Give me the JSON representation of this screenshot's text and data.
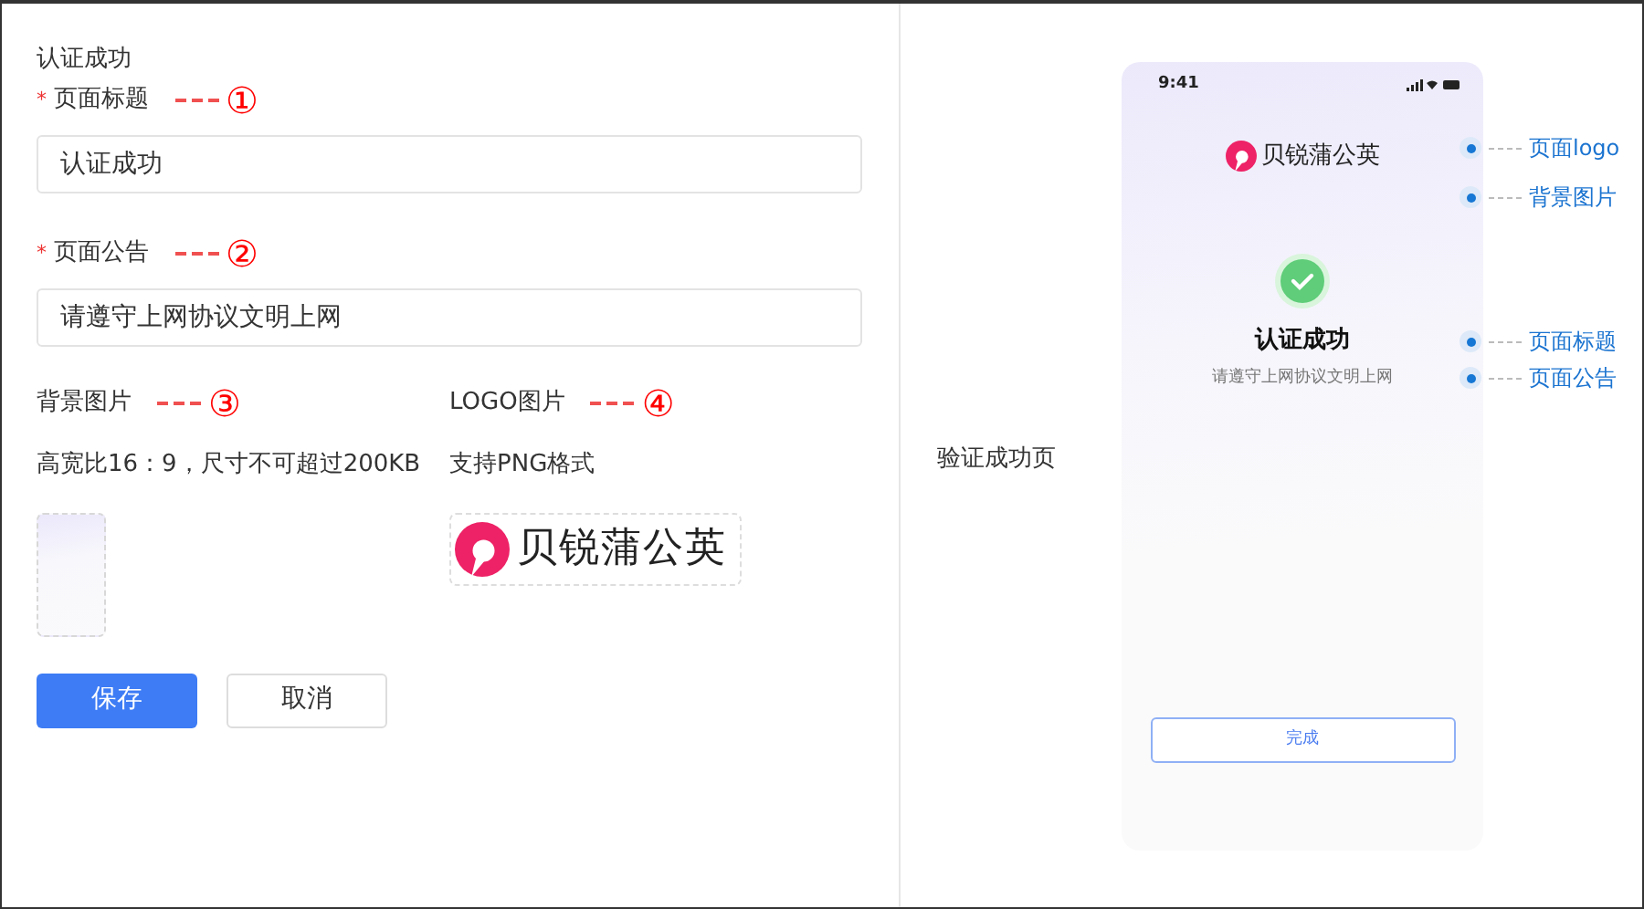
{
  "form": {
    "section_title": "认证成功",
    "fields": [
      {
        "required_mark": "*",
        "label": "页面标题",
        "marker": "①",
        "value": "认证成功"
      },
      {
        "required_mark": "*",
        "label": "页面公告",
        "marker": "②",
        "value": "请遵守上网协议文明上网"
      }
    ],
    "uploads": [
      {
        "kind": "background",
        "label": "背景图片",
        "marker": "③",
        "hint": "高宽比16：9，尺寸不可超过200KB"
      },
      {
        "kind": "logo",
        "label": "LOGO图片",
        "marker": "④",
        "hint": "支持PNG格式",
        "logo_text": "贝锐蒲公英"
      }
    ],
    "buttons": [
      {
        "kind": "primary",
        "label": "保存"
      },
      {
        "kind": "secondary",
        "label": "取消"
      }
    ]
  },
  "preview": {
    "caption": "验证成功页",
    "phone": {
      "time": "9:41",
      "logo_text": "贝锐蒲公英",
      "title": "认证成功",
      "notice": "请遵守上网协议文明上网",
      "button": "完成"
    },
    "callouts": [
      {
        "label": "页面logo"
      },
      {
        "label": "背景图片"
      },
      {
        "label": "页面标题"
      },
      {
        "label": "页面公告"
      }
    ]
  }
}
